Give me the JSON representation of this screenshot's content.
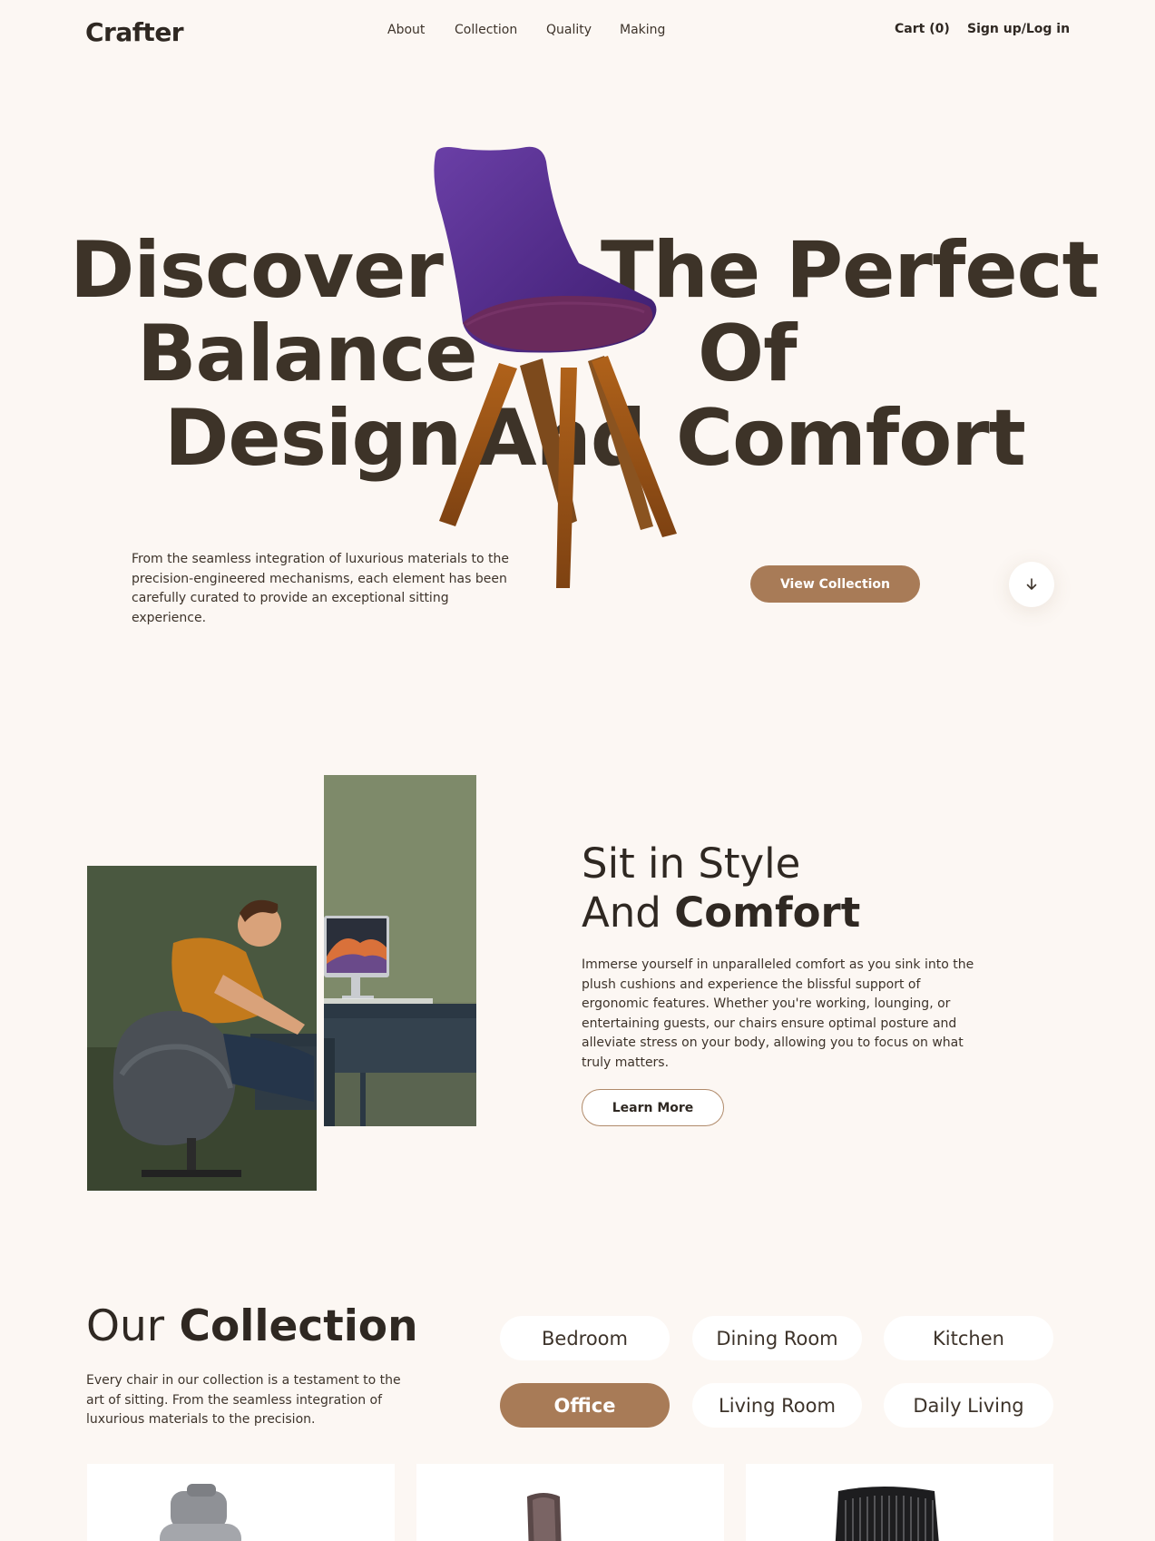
{
  "nav": {
    "logo": "Crafter",
    "links": [
      "About",
      "Collection",
      "Quality",
      "Making"
    ],
    "cart": "Cart (0)",
    "auth": "Sign up/Log in"
  },
  "hero": {
    "title_lines": [
      "Discover",
      "The Perfect",
      "Balance",
      "Of",
      "Design",
      "And",
      "Comfort"
    ],
    "description": "From the seamless integration of luxurious materials to the precision-engineered mechanisms, each element has been carefully curated to provide an exceptional sitting experience.",
    "cta": "View Collection",
    "scroll_icon": "arrow-down-icon"
  },
  "style_section": {
    "heading_line1": "Sit in Style",
    "heading_line2_regular": "And",
    "heading_line2_bold": "Comfort",
    "description": "Immerse yourself in unparalleled comfort as you sink into the plush cushions and experience the blissful support of ergonomic features. Whether you're working, lounging, or entertaining guests, our chairs ensure optimal posture and alleviate stress on your body, allowing you to focus on what truly matters.",
    "cta": "Learn More"
  },
  "collection": {
    "heading_regular": "Our",
    "heading_bold": "Collection",
    "description": "Every chair in our collection is a testament to the art of sitting. From the seamless integration of luxurious materials to the precision.",
    "categories": [
      "Bedroom",
      "Dining Room",
      "Kitchen",
      "Office",
      "Living Room",
      "Daily Living"
    ],
    "active_category": "Office"
  },
  "colors": {
    "background": "#fcf7f3",
    "accent": "#a87b57",
    "heading": "#3d3328",
    "chair": "#5a2f8e"
  }
}
